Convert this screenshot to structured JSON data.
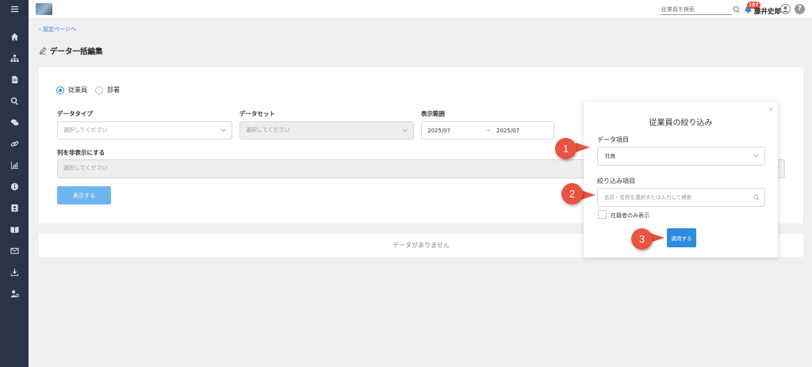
{
  "sidebar": {
    "items": [
      {
        "icon": "home-icon"
      },
      {
        "icon": "org-chart-icon"
      },
      {
        "icon": "document-icon"
      },
      {
        "icon": "search-icon"
      },
      {
        "icon": "chat-icon"
      },
      {
        "icon": "link-icon"
      },
      {
        "icon": "chart-icon"
      },
      {
        "icon": "info-icon"
      },
      {
        "icon": "contact-card-icon"
      },
      {
        "icon": "book-icon"
      },
      {
        "icon": "mail-icon"
      },
      {
        "icon": "download-icon"
      },
      {
        "icon": "user-settings-icon"
      }
    ]
  },
  "topbar": {
    "search_placeholder": "従業員を検索",
    "notification_count": "187",
    "user_name": "藤井史郎",
    "help": "?"
  },
  "breadcrumb": {
    "back": "設定ページへ"
  },
  "page": {
    "title": "データ一括編集"
  },
  "form": {
    "radio_employee": "従業員",
    "radio_department": "部署",
    "data_type_label": "データタイプ",
    "data_type_placeholder": "選択してください",
    "data_set_label": "データセット",
    "data_set_placeholder": "選択してください",
    "range_label": "表示範囲",
    "range_start": "2025/07",
    "range_arrow": "→",
    "range_end": "2025/07",
    "hide_columns_label": "列を非表示にする",
    "hide_columns_placeholder": "選択してください",
    "show_button": "表示する"
  },
  "empty_message": "データがありません",
  "filter_panel": {
    "title": "従業員の絞り込み",
    "close": "×",
    "data_item_label": "データ項目",
    "data_item_value": "社員",
    "filter_item_label": "絞り込み項目",
    "filter_search_placeholder": "名前・名称を選択または入力して検索",
    "active_only_label": "在籍者のみ表示",
    "apply_button": "適用する"
  },
  "callouts": [
    "1",
    "2",
    "3"
  ],
  "colors": {
    "sidebar": "#2c3347",
    "accent": "#2e8de0",
    "callout": "#e9533f",
    "badge": "#e84c3d"
  }
}
